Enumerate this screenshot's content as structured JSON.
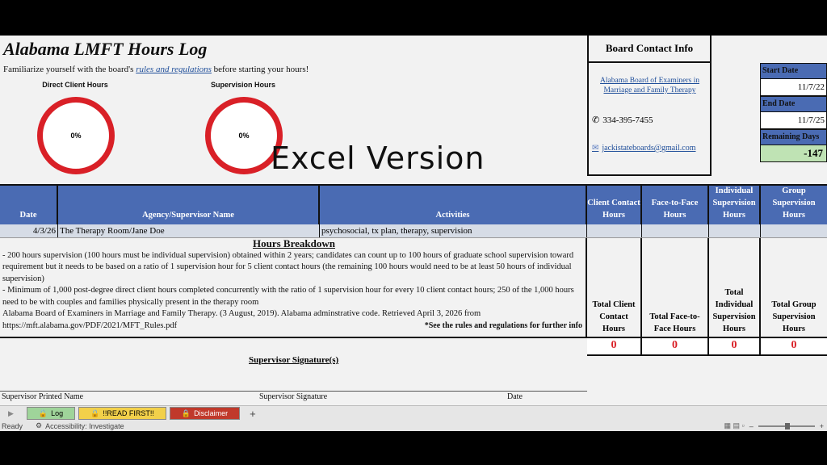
{
  "title": "Alabama LMFT Hours Log",
  "intro": {
    "prefix": "Familiarize yourself with the board's ",
    "link": "rules and regulations",
    "suffix": " before starting your hours!"
  },
  "rings": [
    {
      "label": "Direct Client Hours",
      "value": "0%"
    },
    {
      "label": "Supervision Hours",
      "value": "0%"
    }
  ],
  "banner": "Excel Version",
  "board": {
    "title": "Board Contact Info",
    "link": "Alabama Board of Examiners in Marriage and Family Therapy",
    "phone": "334-395-7455",
    "email": "jackistateboards@gmail.com"
  },
  "dates": {
    "start_label": "Start Date",
    "start_value": "11/7/22",
    "end_label": "End Date",
    "end_value": "11/7/25",
    "remaining_label": "Remaining Days",
    "remaining_value": "-147"
  },
  "columns": [
    "Date",
    "Agency/Supervisor Name",
    "Activities",
    "Client Contact Hours",
    "Face-to-Face Hours",
    "Individual Supervision Hours",
    "Group Supervision Hours"
  ],
  "rows": [
    {
      "date": "4/3/26",
      "agency": "The Therapy Room/Jane Doe",
      "activities": "psychosocial, tx plan, therapy, supervision",
      "client": "",
      "face": "",
      "individual": "",
      "group": ""
    }
  ],
  "breakdown": {
    "title": "Hours Breakdown",
    "line1": "- 200 hours supervision (100 hours must be individual supervision) obtained within 2 years; candidates can count up to 100 hours of graduate school supervision toward requirement but it needs to be based on a ratio of 1 supervision hour for 5 client contact hours (the remaining 100 hours would need to be at least 50 hours of individual supervision)",
    "line2": "- Minimum of 1,000 post-degree direct client hours completed concurrently with the ratio of 1 supervision hour for every 10 client contact hours; 250 of the 1,000 hours need to be with couples and families physically present in the therapy room",
    "citation": "Alabama Board of Examiners in Marriage and Family Therapy. (3 August, 2019). Alabama adminstrative code. Retrieved April 3, 2026 from https://mft.alabama.gov/PDF/2021/MFT_Rules.pdf",
    "note": "*See the rules and regulations for further info"
  },
  "totals": [
    {
      "label": "Total Client Contact Hours",
      "value": "0"
    },
    {
      "label": "Total Face-to-Face Hours",
      "value": "0"
    },
    {
      "label": "Total Individual Supervision Hours",
      "value": "0"
    },
    {
      "label": "Total Group Supervision Hours",
      "value": "0"
    }
  ],
  "signature": {
    "title": "Supervisor Signature(s)",
    "printed": "Supervisor Printed Name",
    "sign": "Supervisor Signature",
    "date": "Date"
  },
  "tabs": [
    {
      "label": "Log",
      "color": "#9fd49a"
    },
    {
      "label": "!!READ FIRST!!",
      "color": "#f2d04a"
    },
    {
      "label": "Disclaimer",
      "color": "#c0392b"
    }
  ],
  "add_tab": "+",
  "status": {
    "ready": "Ready",
    "accessibility": "Accessibility: Investigate"
  },
  "colors": {
    "header_blue": "#4a6bb3",
    "ring_red": "#d92027",
    "total_red": "#d92027",
    "remaining_green": "#bfe3b4"
  }
}
